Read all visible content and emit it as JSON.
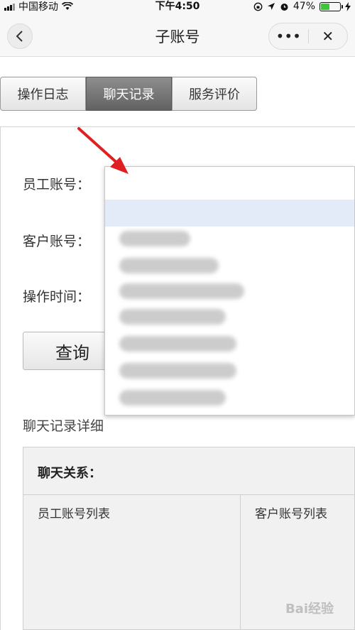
{
  "status_bar": {
    "carrier": "中国移动",
    "time": "下午4:50",
    "battery_percent": "47%",
    "battery_level": 0.47
  },
  "nav": {
    "title": "子账号",
    "more_label": "•••",
    "close_label": "✕"
  },
  "tabs": [
    {
      "label": "操作日志",
      "active": false
    },
    {
      "label": "聊天记录",
      "active": true
    },
    {
      "label": "服务评价",
      "active": false
    }
  ],
  "form": {
    "employee_account_label": "员工账号：",
    "customer_account_label": "客户账号：",
    "operation_time_label": "操作时间：",
    "query_button": "查询"
  },
  "dropdown": {
    "selected_value": "",
    "options": [
      "",
      "",
      "",
      "",
      "",
      "",
      ""
    ]
  },
  "detail": {
    "section_title": "聊天记录详细",
    "relation_label": "聊天关系：",
    "employee_list_header": "员工账号列表",
    "customer_list_header": "客户账号列表"
  },
  "watermark": "Bai经验",
  "colors": {
    "active_tab": "#6f6f6f",
    "annotation_arrow": "#e02020",
    "selected_option": "#e3eaf8",
    "battery_fill": "#3cc63c"
  },
  "icons": [
    "back-icon",
    "more-icon",
    "close-icon",
    "wifi-icon",
    "location-icon",
    "alarm-icon",
    "lock-rotation-icon",
    "charging-icon"
  ]
}
